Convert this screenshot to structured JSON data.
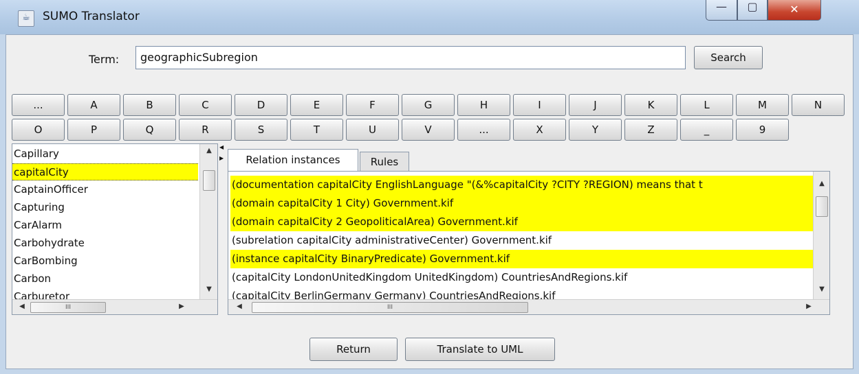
{
  "window": {
    "title": "SUMO Translator",
    "controls": {
      "minimize": "—",
      "maximize": "▢",
      "close": "✕"
    }
  },
  "search": {
    "label": "Term:",
    "value": "geographicSubregion",
    "button": "Search"
  },
  "letters_row1": [
    "...",
    "A",
    "B",
    "C",
    "D",
    "E",
    "F",
    "G",
    "H",
    "I",
    "J",
    "K",
    "L",
    "M",
    "N"
  ],
  "letters_row2": [
    "O",
    "P",
    "Q",
    "R",
    "S",
    "T",
    "U",
    "V",
    "...",
    "X",
    "Y",
    "Z",
    "_",
    "9"
  ],
  "term_list": {
    "items": [
      "Capillary",
      "capitalCity",
      "CaptainOfficer",
      "Capturing",
      "CarAlarm",
      "Carbohydrate",
      "CarBombing",
      "Carbon",
      "Carburetor"
    ],
    "selected_index": 1
  },
  "tabs": {
    "relation_instances": "Relation instances",
    "rules": "Rules"
  },
  "relations": [
    {
      "text": "(documentation capitalCity EnglishLanguage \"(&%capitalCity ?CITY ?REGION) means that t",
      "highlighted": true
    },
    {
      "text": "(domain capitalCity 1 City)  Government.kif",
      "highlighted": true
    },
    {
      "text": "(domain capitalCity 2 GeopoliticalArea)  Government.kif",
      "highlighted": true
    },
    {
      "text": "(subrelation capitalCity administrativeCenter)  Government.kif",
      "highlighted": false
    },
    {
      "text": "(instance capitalCity BinaryPredicate)  Government.kif",
      "highlighted": true
    },
    {
      "text": "(capitalCity LondonUnitedKingdom UnitedKingdom)  CountriesAndRegions.kif",
      "highlighted": false
    },
    {
      "text": "(capitalCity BerlinGermany Germany)  CountriesAndRegions.kif",
      "highlighted": false
    }
  ],
  "footer": {
    "return_label": "Return",
    "translate_label": "Translate to UML"
  },
  "colors": {
    "highlight": "#ffff00",
    "close_button": "#c8462f",
    "titlebar": "#b3cbe6"
  },
  "scroll_grip": "III"
}
